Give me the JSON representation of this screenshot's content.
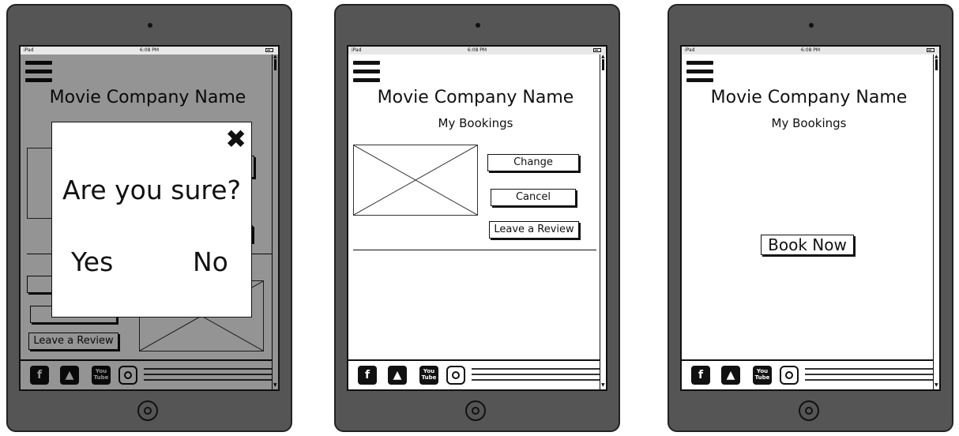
{
  "status": {
    "carrier": "iPad",
    "time": "6:08 PM"
  },
  "header": {
    "company_name": "Movie Company Name",
    "subtitle": "My Bookings"
  },
  "booking": {
    "change_label": "Change",
    "cancel_label": "Cancel",
    "review_label": "Leave a Review"
  },
  "empty": {
    "book_now_label": "Book Now"
  },
  "modal": {
    "question": "Are you sure?",
    "yes_label": "Yes",
    "no_label": "No",
    "close_icon": "close-icon"
  },
  "footer": {
    "icons": [
      "facebook-icon",
      "twitter-icon",
      "youtube-icon",
      "instagram-icon"
    ],
    "youtube_text": "You Tube"
  },
  "colors": {
    "device": "#555555",
    "overlay": "#6b6b6b",
    "ink": "#111111"
  }
}
